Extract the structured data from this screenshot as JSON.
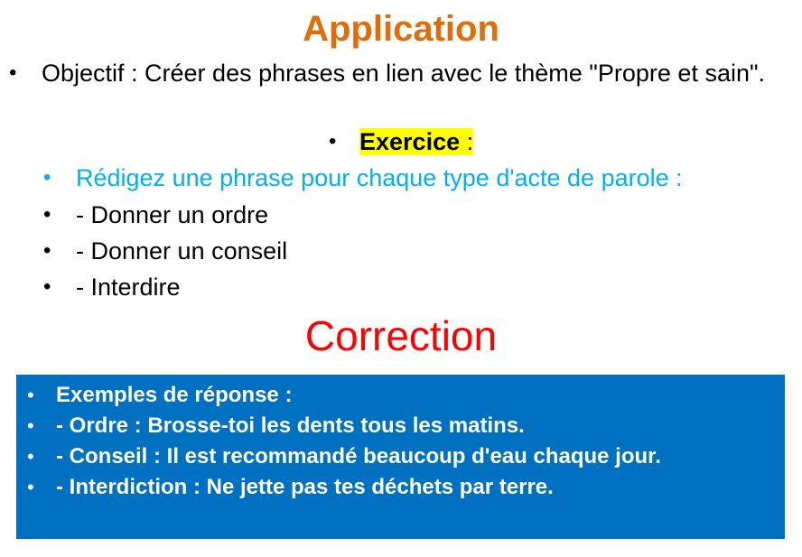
{
  "title": "Application",
  "objective": "Objectif : Créer des phrases en lien avec le thème \"Propre et sain\".",
  "exercise": {
    "label": "Exercice",
    "colon": " :"
  },
  "instruction": "Rédigez une phrase pour chaque type d'acte de parole :",
  "tasks": [
    "- Donner un ordre",
    "- Donner un conseil",
    "- Interdire"
  ],
  "correction_title": "Correction",
  "answers": [
    "Exemples de réponse :",
    "- Ordre : Brosse-toi les dents tous les matins.",
    "- Conseil : Il est recommandé beaucoup d'eau chaque jour.",
    "- Interdiction : Ne jette pas tes déchets par terre."
  ],
  "bullet": "•",
  "colors": {
    "title": "#e36c0a",
    "correction_title": "#ff0000",
    "instruction": "#00b0f0",
    "highlight": "#ffff00",
    "answer_box": "#0070c0",
    "answer_text": "#ffffff"
  }
}
